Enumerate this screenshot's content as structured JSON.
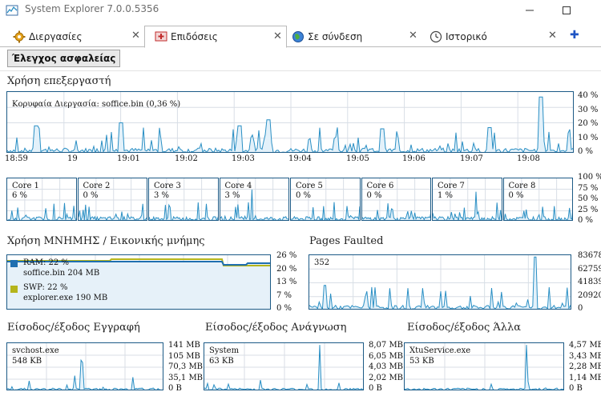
{
  "window": {
    "title": "System Explorer 7.0.0.5356"
  },
  "tabs": [
    {
      "label": "Διεργασίες",
      "icon": "gear-icon",
      "active": false
    },
    {
      "label": "Επιδόσεις",
      "icon": "monitor-icon",
      "active": true
    },
    {
      "label": "Σε σύνδεση",
      "icon": "globe-icon",
      "active": false
    },
    {
      "label": "Ιστορικό",
      "icon": "clock-icon",
      "active": false
    }
  ],
  "toolbar": {
    "security_button": "Έλεγχος ασφαλείας"
  },
  "cpu": {
    "title": "Χρήση επεξεργαστή",
    "top_process": "Κορυφαία Διεργασία: soffice.bin (0,36 %)",
    "y_ticks": [
      "40 %",
      "30 %",
      "20 %",
      "10 %",
      "0 %"
    ],
    "time_labels": [
      "18:59",
      "19",
      "19:01",
      "19:02",
      "19:03",
      "19:04",
      "19:05",
      "19:06",
      "19:07",
      "19:08"
    ],
    "line_color": "#2a8fc4"
  },
  "cores": {
    "labels": [
      {
        "name": "Core 1",
        "value": "6 %"
      },
      {
        "name": "Core 2",
        "value": "0 %"
      },
      {
        "name": "Core 3",
        "value": "3 %"
      },
      {
        "name": "Core 4",
        "value": "3 %"
      },
      {
        "name": "Core 5",
        "value": "0 %"
      },
      {
        "name": "Core 6",
        "value": "0 %"
      },
      {
        "name": "Core 7",
        "value": "1 %"
      },
      {
        "name": "Core 8",
        "value": "0 %"
      }
    ],
    "y_ticks": [
      "100 %",
      "75 %",
      "50 %",
      "25 %",
      "0 %"
    ]
  },
  "memory": {
    "title": "Χρήση ΜΝΗΜΗΣ / Εικονικής μνήμης",
    "ram_label": "RAM: 22 %",
    "ram_process": "soffice.bin 204 MB",
    "swp_label": "SWP: 22 %",
    "swp_process": "explorer.exe 190 MB",
    "ram_color": "#1f6fb0",
    "swp_color": "#b5b51c",
    "y_ticks": [
      "26 %",
      "20 %",
      "13 %",
      "7 %",
      "0 %"
    ]
  },
  "pages": {
    "title": "Pages Faulted",
    "value_label": "352",
    "y_ticks": [
      "83678",
      "62759",
      "41839",
      "20920",
      "0"
    ]
  },
  "io_write": {
    "title": "Είσοδος/έξοδος Εγγραφή",
    "process": "svchost.exe",
    "value": "548 KB",
    "y_ticks": [
      "141 MB",
      "105 MB",
      "70,3 MB",
      "35,1 MB",
      "0 B"
    ]
  },
  "io_read": {
    "title": "Είσοδος/έξοδος Ανάγνωση",
    "process": "System",
    "value": "63 KB",
    "y_ticks": [
      "8,07 MB",
      "6,05 MB",
      "4,03 MB",
      "2,02 MB",
      "0 B"
    ]
  },
  "io_other": {
    "title": "Είσοδος/έξοδος Άλλα",
    "process": "XtuService.exe",
    "value": "53 KB",
    "y_ticks": [
      "4,57 MB",
      "3,43 MB",
      "2,28 MB",
      "1,14 MB",
      "0 B"
    ]
  }
}
